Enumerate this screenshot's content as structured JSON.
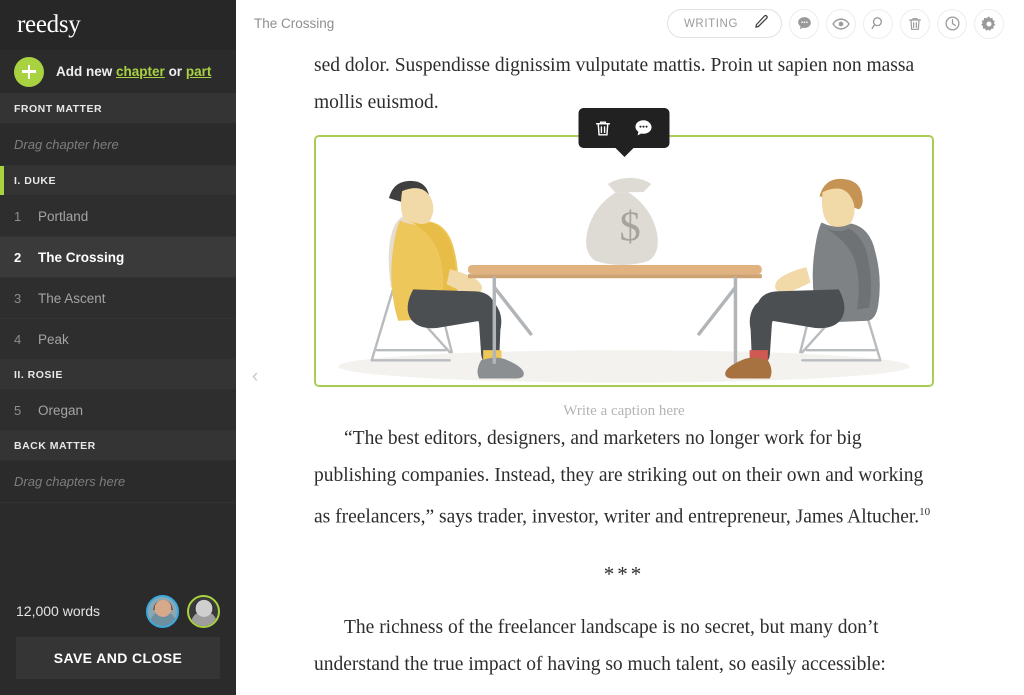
{
  "brand": "reedsy",
  "sidebar": {
    "add_new": {
      "prefix": "Add new",
      "chapter": "chapter",
      "or": "or",
      "part": "part"
    },
    "front_matter_label": "FRONT MATTER",
    "front_matter_drag": "Drag chapter here",
    "parts": [
      {
        "label": "I. DUKE",
        "active": true
      },
      {
        "label": "II. ROSIE",
        "active": false
      }
    ],
    "chapters_part1": [
      {
        "num": "1",
        "title": "Portland",
        "active": false
      },
      {
        "num": "2",
        "title": "The Crossing",
        "active": true
      },
      {
        "num": "3",
        "title": "The Ascent",
        "active": false
      },
      {
        "num": "4",
        "title": "Peak",
        "active": false
      }
    ],
    "chapters_part2": [
      {
        "num": "5",
        "title": "Oregan",
        "active": false
      }
    ],
    "back_matter_label": "BACK MATTER",
    "back_matter_drag": "Drag chapters here",
    "word_count": "12,000 words",
    "save_button": "SAVE AND CLOSE",
    "accent_color": "#a9d240"
  },
  "topbar": {
    "doc_title": "The Crossing",
    "mode_pill": {
      "label": "WRITING",
      "icon": "pencil-icon"
    },
    "icons": [
      {
        "name": "comment-icon"
      },
      {
        "name": "eye-icon"
      },
      {
        "name": "search-icon"
      },
      {
        "name": "trash-icon"
      },
      {
        "name": "history-clock-icon"
      },
      {
        "name": "gear-icon"
      }
    ]
  },
  "editor": {
    "paragraph_top": "sed dolor. Suspendisse dignissim vulputate mattis. Proin ut sapien non massa mollis euismod.",
    "figure": {
      "caption_placeholder": "Write a caption here",
      "selected_border_color": "#a8cd4f",
      "toolbar": [
        {
          "name": "trash-icon"
        },
        {
          "name": "comment-icon"
        }
      ],
      "alt": "Two businessmen sitting on chairs facing each other across a table with a money bag"
    },
    "quote_paragraph": "“The best editors, designers, and marketers no longer work for big publishing companies. Instead, they are striking out on their own and working as freelancers,” says trader, investor, writer and entrepreneur, James Altucher.",
    "footnote_marker": "10",
    "scene_divider": "***",
    "paragraph_bottom": "The richness of the freelancer landscape is no secret, but many don’t understand the true impact of having so much talent, so easily accessible:",
    "collapse_chevron": "‹"
  }
}
